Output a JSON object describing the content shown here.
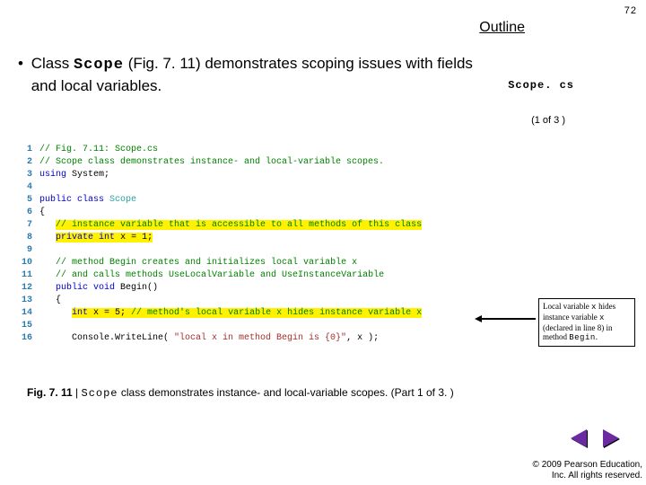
{
  "page_number": "72",
  "outline_label": "Outline",
  "bullet": {
    "pre": "Class ",
    "class_name": "Scope",
    "post": " (Fig. 7. 11) demonstrates scoping issues with fields and local variables."
  },
  "sidebar": {
    "filename": "Scope. cs",
    "part": "(1 of 3 )"
  },
  "code": [
    {
      "n": "1",
      "seg": [
        {
          "t": "// Fig. 7.11: Scope.cs",
          "c": "c-comment"
        }
      ]
    },
    {
      "n": "2",
      "seg": [
        {
          "t": "// Scope class demonstrates instance- and local-variable scopes.",
          "c": "c-comment"
        }
      ]
    },
    {
      "n": "3",
      "seg": [
        {
          "t": "using ",
          "c": "c-key"
        },
        {
          "t": "System;",
          "c": ""
        }
      ]
    },
    {
      "n": "4",
      "seg": []
    },
    {
      "n": "5",
      "seg": [
        {
          "t": "public class ",
          "c": "c-key"
        },
        {
          "t": "Scope",
          "c": "c-type"
        }
      ]
    },
    {
      "n": "6",
      "seg": [
        {
          "t": "{",
          "c": ""
        }
      ]
    },
    {
      "n": "7",
      "seg": [
        {
          "t": "   ",
          "c": ""
        },
        {
          "t": "// instance variable that is accessible to all methods of this class",
          "c": "c-comment",
          "hl": true
        }
      ]
    },
    {
      "n": "8",
      "seg": [
        {
          "t": "   ",
          "c": ""
        },
        {
          "t": "private",
          "c": "c-key",
          "hl": true
        },
        {
          "t": " ",
          "c": "",
          "hl": true
        },
        {
          "t": "int",
          "c": "c-key",
          "hl": true
        },
        {
          "t": " x = 1;",
          "c": "",
          "hl": true
        }
      ]
    },
    {
      "n": "9",
      "seg": []
    },
    {
      "n": "10",
      "seg": [
        {
          "t": "   ",
          "c": ""
        },
        {
          "t": "// method Begin creates and initializes local variable x",
          "c": "c-comment"
        }
      ]
    },
    {
      "n": "11",
      "seg": [
        {
          "t": "   ",
          "c": ""
        },
        {
          "t": "// and calls methods UseLocalVariable and UseInstanceVariable",
          "c": "c-comment"
        }
      ]
    },
    {
      "n": "12",
      "seg": [
        {
          "t": "   ",
          "c": ""
        },
        {
          "t": "public void",
          "c": "c-key"
        },
        {
          "t": " Begin()",
          "c": ""
        }
      ]
    },
    {
      "n": "13",
      "seg": [
        {
          "t": "   {",
          "c": ""
        }
      ]
    },
    {
      "n": "14",
      "seg": [
        {
          "t": "      ",
          "c": ""
        },
        {
          "t": "int",
          "c": "c-key",
          "hl": true
        },
        {
          "t": " x = 5; ",
          "c": "",
          "hl": true
        },
        {
          "t": "// method's local variable x hides instance variable x",
          "c": "c-comment",
          "hl": true
        }
      ]
    },
    {
      "n": "15",
      "seg": []
    },
    {
      "n": "16",
      "seg": [
        {
          "t": "      Console.WriteLine( ",
          "c": ""
        },
        {
          "t": "\"local x in method Begin is {0}\"",
          "c": "c-str"
        },
        {
          "t": ", x );",
          "c": ""
        }
      ]
    }
  ],
  "callout": {
    "l1": "Local variable ",
    "v1": "x",
    "l2": " hides instance variable ",
    "v2": "x",
    "l3": " (declared in line 8) in method ",
    "m": "Begin",
    "l4": "."
  },
  "caption": {
    "fig": "Fig. 7. 11",
    "sep": " | ",
    "cls": "Scope",
    "rest": " class demonstrates instance- and local-variable scopes. (Part 1 of 3. )"
  },
  "copyright": {
    "l1": "© 2009 Pearson Education,",
    "l2": "Inc.  All rights reserved."
  }
}
